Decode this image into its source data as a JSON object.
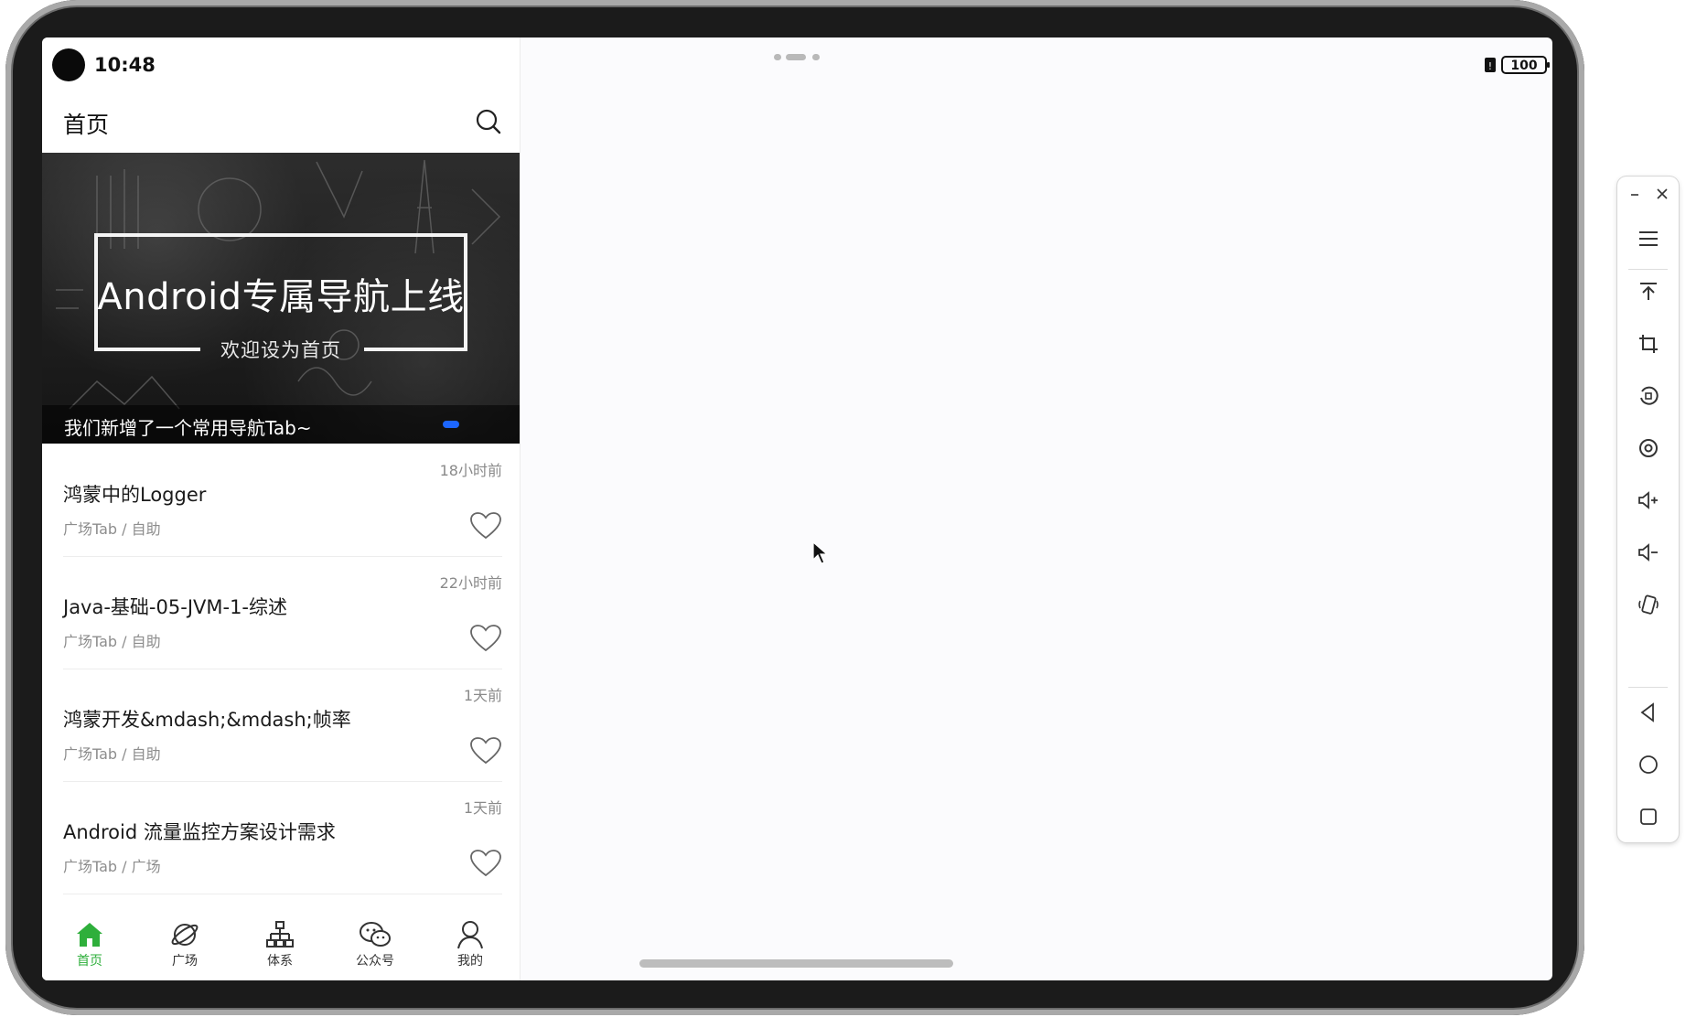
{
  "status_bar": {
    "time": "10:48",
    "battery": "100"
  },
  "header": {
    "title": "首页"
  },
  "banner": {
    "heading": "Android专属导航上线",
    "subheading": "欢迎设为首页",
    "caption": "我们新增了一个常用导航Tab~"
  },
  "articles": [
    {
      "time": "18小时前",
      "title": "鸿蒙中的Logger",
      "category": "广场Tab / 自助"
    },
    {
      "time": "22小时前",
      "title": "Java-基础-05-JVM-1-综述",
      "category": "广场Tab / 自助"
    },
    {
      "time": "1天前",
      "title": "鸿蒙开发&mdash;&mdash;帧率",
      "category": "广场Tab / 自助"
    },
    {
      "time": "1天前",
      "title": "Android 流量监控方案设计需求",
      "category": "广场Tab / 广场"
    }
  ],
  "bottom_nav": [
    {
      "label": "首页",
      "icon": "home-icon",
      "active": true
    },
    {
      "label": "广场",
      "icon": "planet-icon",
      "active": false
    },
    {
      "label": "体系",
      "icon": "tree-icon",
      "active": false
    },
    {
      "label": "公众号",
      "icon": "wechat-icon",
      "active": false
    },
    {
      "label": "我的",
      "icon": "person-icon",
      "active": false
    }
  ],
  "colors": {
    "accent": "#2eaf3b",
    "banner_dot": "#1c66ff"
  },
  "toolbar": {
    "items": [
      "minimize-icon",
      "close-icon",
      "menu-icon",
      "pin-top-icon",
      "crop-icon",
      "rotate-icon",
      "screenshot-icon",
      "volume-up-icon",
      "volume-down-icon",
      "shake-icon",
      "back-icon",
      "home-icon",
      "recents-icon"
    ]
  }
}
